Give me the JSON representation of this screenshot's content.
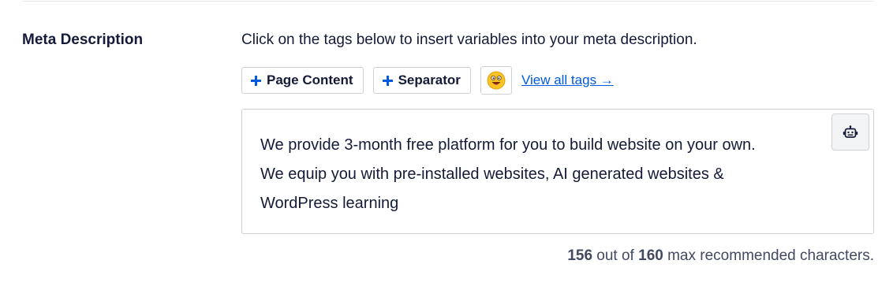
{
  "field": {
    "label": "Meta Description",
    "instructions": "Click on the tags below to insert variables into your meta description."
  },
  "tags": {
    "buttons": [
      {
        "label": "Page Content",
        "icon": "plus-icon"
      },
      {
        "label": "Separator",
        "icon": "plus-icon"
      }
    ],
    "emoji_icon": "emoji-face-icon",
    "view_all_label": "View all tags →"
  },
  "editor": {
    "value": "We provide 3-month free platform for you to build website on your own. We equip you with pre-installed websites, AI generated websites & WordPress learning",
    "ai_button_icon": "robot-icon"
  },
  "char_count": {
    "current": "156",
    "middle": " out of ",
    "max": "160",
    "suffix": " max recommended characters."
  },
  "colors": {
    "accent": "#005ae0",
    "text": "#141b38",
    "muted": "#434960",
    "border": "#d0d1d7"
  }
}
